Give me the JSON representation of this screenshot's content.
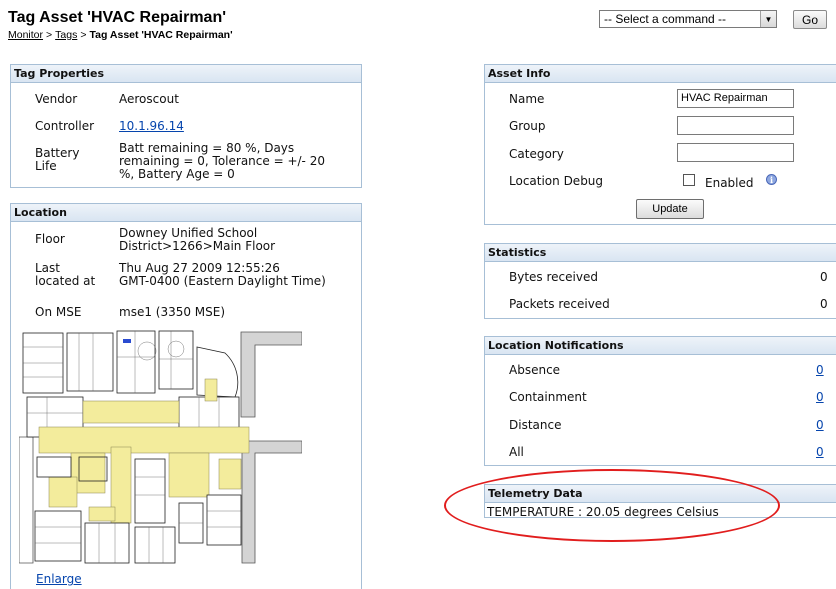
{
  "header": {
    "title": "Tag Asset 'HVAC Repairman'",
    "breadcrumb": {
      "items": [
        "Monitor",
        "Tags"
      ],
      "separator": ">",
      "current": "Tag Asset 'HVAC Repairman'"
    },
    "command_select": "-- Select a command --",
    "go_label": "Go"
  },
  "tag_properties": {
    "heading": "Tag Properties",
    "vendor_label": "Vendor",
    "vendor": "Aeroscout",
    "controller_label": "Controller",
    "controller": "10.1.96.14",
    "battery_label_1": "Battery",
    "battery_label_2": "Life",
    "battery_line1": "Batt remaining = 80 %, Days",
    "battery_line2": "remaining = 0, Tolerance = +/- 20",
    "battery_line3": "%, Battery Age = 0"
  },
  "location": {
    "heading": "Location",
    "floor_label": "Floor",
    "floor_line1": "Downey Unified School",
    "floor_line2": "District>1266>Main Floor",
    "last_label_1": "Last",
    "last_label_2": "located at",
    "last_line1": "Thu Aug 27 2009 12:55:26",
    "last_line2": "GMT-0400 (Eastern Daylight Time)",
    "mse_label": "On MSE",
    "mse_value": "mse1  (3350 MSE)",
    "enlarge": "Enlarge"
  },
  "asset_info": {
    "heading": "Asset Info",
    "name_label": "Name",
    "name_value": "HVAC Repairman",
    "group_label": "Group",
    "group_value": "",
    "category_label": "Category",
    "category_value": "",
    "debug_label": "Location Debug",
    "enabled_label": "Enabled",
    "debug_enabled": false,
    "update_label": "Update"
  },
  "statistics": {
    "heading": "Statistics",
    "rows": [
      {
        "label": "Bytes received",
        "value": "0"
      },
      {
        "label": "Packets received",
        "value": "0"
      }
    ]
  },
  "location_notifications": {
    "heading": "Location Notifications",
    "rows": [
      {
        "label": "Absence",
        "value": "0"
      },
      {
        "label": "Containment",
        "value": "0"
      },
      {
        "label": "Distance",
        "value": "0"
      },
      {
        "label": "All",
        "value": "0"
      }
    ]
  },
  "telemetry": {
    "heading": "Telemetry Data",
    "text": "TEMPERATURE : 20.05 degrees Celsius"
  },
  "colors": {
    "panel_border": "#a7bfd6",
    "panel_header": "#dbe6f2",
    "link": "#0645ad",
    "highlight_ellipse": "#e11d1d",
    "map_highlight": "#f3ec9c"
  }
}
